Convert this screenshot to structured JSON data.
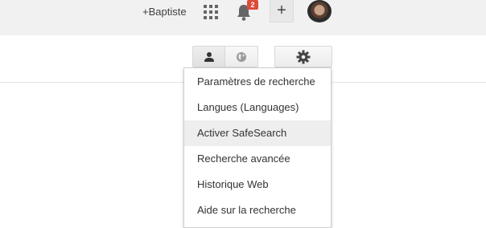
{
  "header": {
    "profile_link": "+Baptiste",
    "notification_count": "2",
    "plus_label": "+"
  },
  "icons": {
    "apps": "apps-grid-icon",
    "notifications": "bell-icon",
    "person": "person-icon",
    "globe": "globe-icon",
    "settings": "gear-icon"
  },
  "colors": {
    "badge": "#dd4b39",
    "topbar": "#f1f1f1",
    "menu_hover": "#eeeeee"
  },
  "settings_menu": {
    "items": [
      {
        "label": "Paramètres de recherche"
      },
      {
        "label": "Langues  (Languages)"
      },
      {
        "label": "Activer SafeSearch",
        "highlighted": true
      },
      {
        "label": "Recherche avancée"
      },
      {
        "label": "Historique Web"
      },
      {
        "label": "Aide sur la recherche"
      }
    ]
  }
}
